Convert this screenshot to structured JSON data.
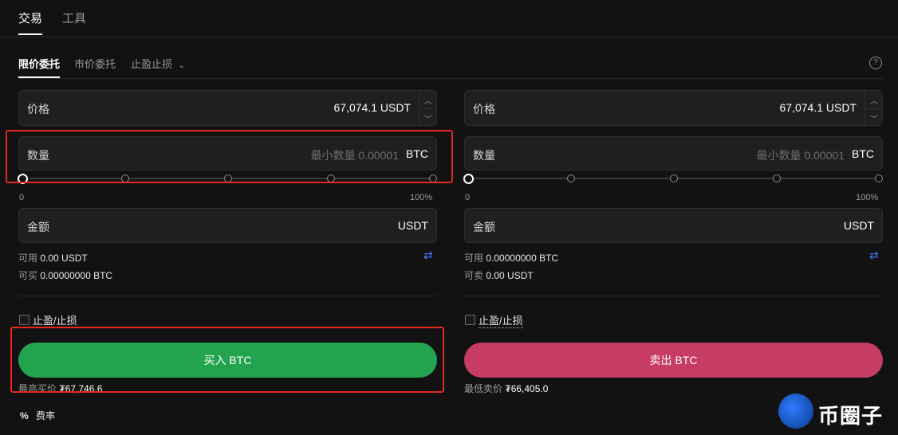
{
  "top_tabs": [
    "交易",
    "工具"
  ],
  "sub_tabs": {
    "limit": "限价委托",
    "market": "市价委托",
    "tpsl": "止盈止损"
  },
  "help_icon": "?",
  "buy": {
    "price_label": "价格",
    "price_value": "67,074.1",
    "price_unit": "USDT",
    "qty_label": "数量",
    "qty_placeholder": "最小数量 0.00001",
    "qty_unit": "BTC",
    "slider_min": "0",
    "slider_max": "100%",
    "slider_value": 0,
    "amount_label": "金额",
    "amount_unit": "USDT",
    "avail_label": "可用",
    "avail_value": "0.00 USDT",
    "can_label": "可买",
    "can_value": "0.00000000 BTC",
    "tpsl_label": "止盈/止损",
    "button": "买入 BTC",
    "best_label": "最高买价",
    "best_value": "₮67,746.6"
  },
  "sell": {
    "price_label": "价格",
    "price_value": "67,074.1",
    "price_unit": "USDT",
    "qty_label": "数量",
    "qty_placeholder": "最小数量 0.00001",
    "qty_unit": "BTC",
    "slider_min": "0",
    "slider_max": "100%",
    "slider_value": 0,
    "amount_label": "金额",
    "amount_unit": "USDT",
    "avail_label": "可用",
    "avail_value": "0.00000000 BTC",
    "can_label": "可卖",
    "can_value": "0.00 USDT",
    "tpsl_label": "止盈/止损",
    "button": "卖出 BTC",
    "best_label": "最低卖价",
    "best_value": "₮66,405.0"
  },
  "fee_label": "费率",
  "fee_icon": "%",
  "watermark": "币圈子",
  "colors": {
    "buy": "#24a34f",
    "sell": "#c73c63",
    "highlight": "#e02a1f",
    "accent": "#3d7bff"
  }
}
